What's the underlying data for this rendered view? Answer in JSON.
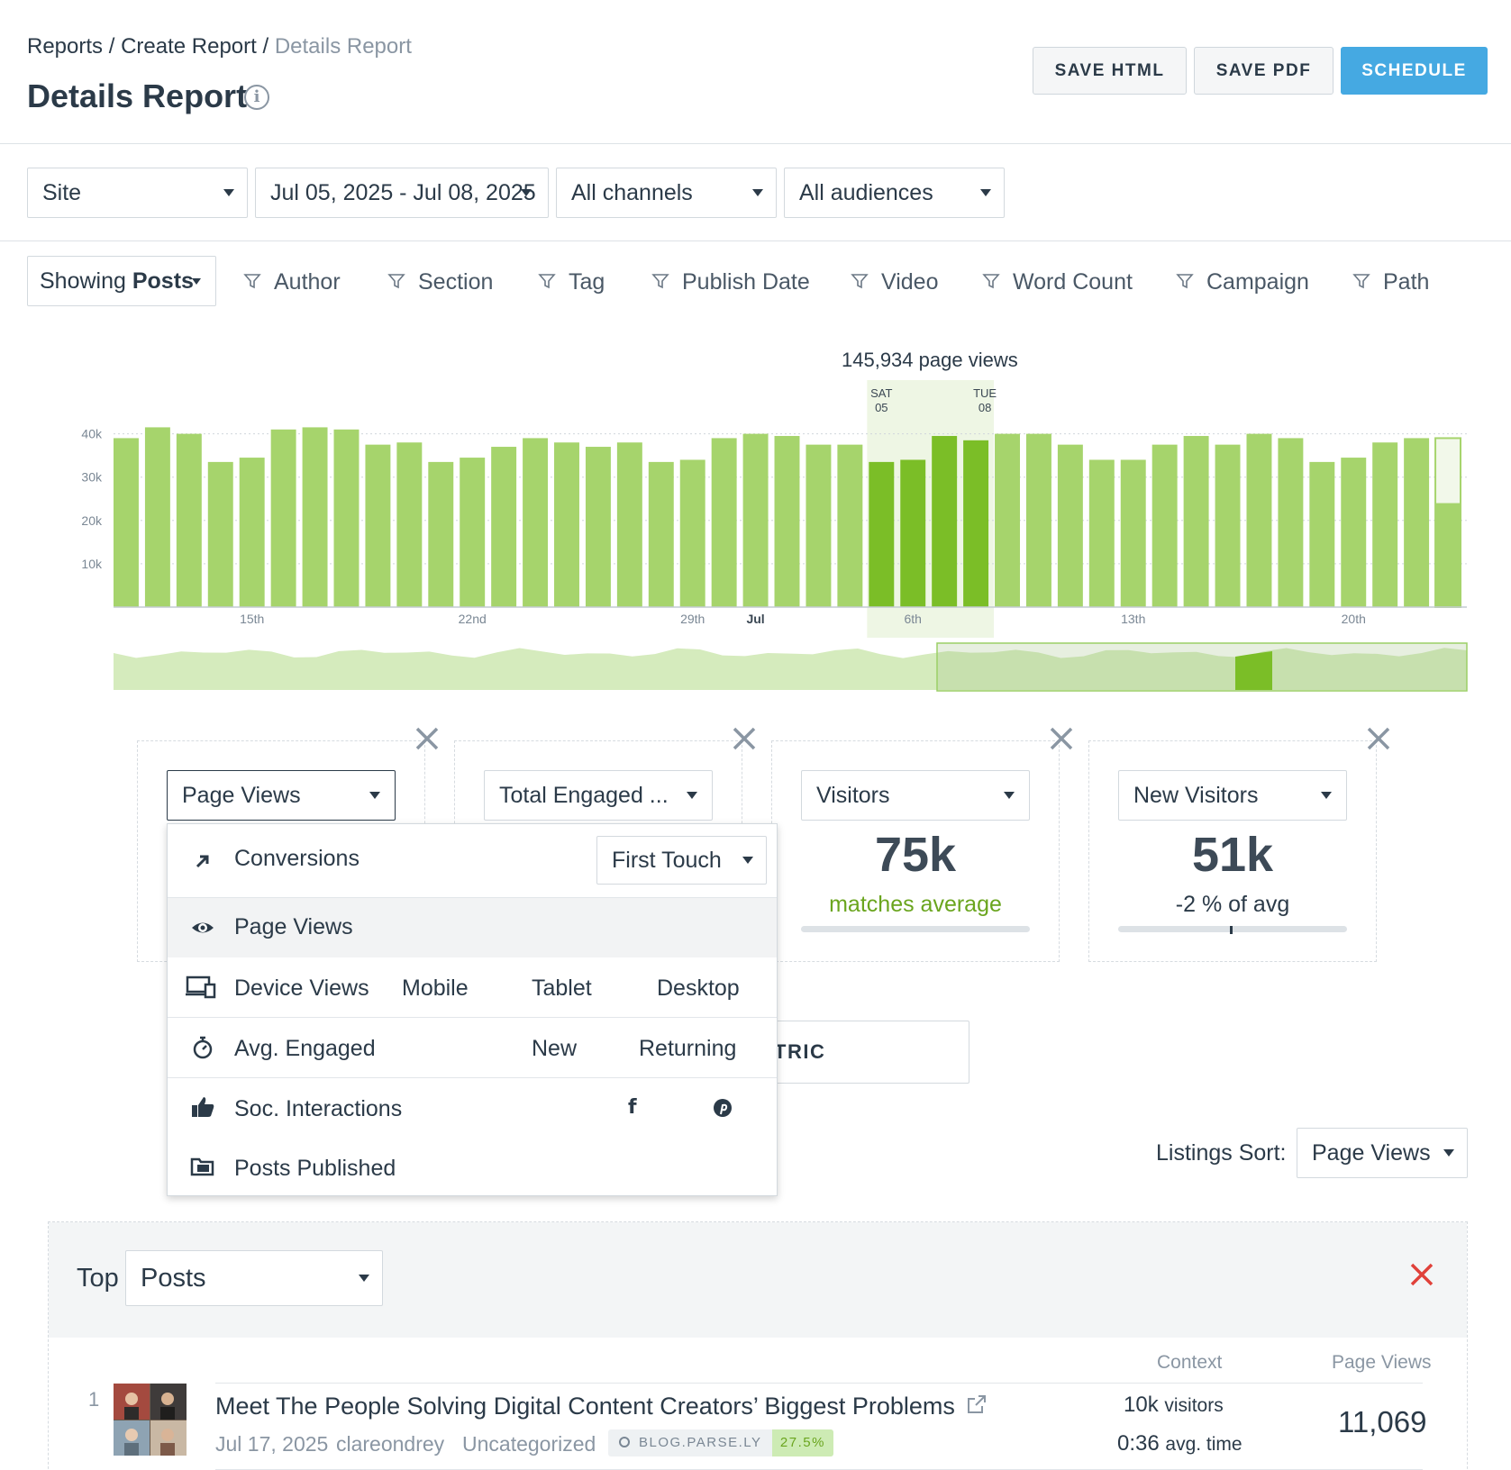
{
  "header": {
    "breadcrumb": [
      "Reports",
      "Create Report",
      "Details Report"
    ],
    "breadcrumb_sep": "/",
    "title": "Details Report",
    "buttons": {
      "save_html": "SAVE HTML",
      "save_pdf": "SAVE PDF",
      "schedule": "SCHEDULE"
    }
  },
  "filters": {
    "site": "Site",
    "date_range": "Jul 05, 2025 - Jul 08, 2025",
    "channels": "All channels",
    "audiences": "All audiences"
  },
  "content_filters": {
    "showing_prefix": "Showing",
    "showing_value": "Posts",
    "items": [
      "Author",
      "Section",
      "Tag",
      "Publish Date",
      "Video",
      "Word Count",
      "Campaign",
      "Path"
    ]
  },
  "chart_data": {
    "type": "bar",
    "title": "145,934 page views",
    "selection_start": {
      "day": "SAT",
      "date": "05"
    },
    "selection_end": {
      "day": "TUE",
      "date": "08"
    },
    "y_ticks": [
      "40k",
      "30k",
      "20k",
      "10k"
    ],
    "ylim": [
      0,
      42000
    ],
    "x_tick_labels": [
      {
        "label": "15th",
        "index": 4
      },
      {
        "label": "22nd",
        "index": 11
      },
      {
        "label": "29th",
        "index": 18
      },
      {
        "label": "Jul",
        "index": 20,
        "bold": true
      },
      {
        "label": "6th",
        "index": 25
      },
      {
        "label": "13th",
        "index": 32
      },
      {
        "label": "20th",
        "index": 39
      }
    ],
    "values": [
      39000,
      41500,
      40000,
      33500,
      34500,
      41000,
      41500,
      41000,
      37500,
      38000,
      33500,
      34500,
      37000,
      39000,
      38000,
      37000,
      38000,
      33500,
      34000,
      39000,
      40000,
      39500,
      37500,
      37500,
      33500,
      34000,
      39500,
      38500,
      40000,
      40000,
      37500,
      34000,
      34000,
      37500,
      39500,
      37500,
      40000,
      39000,
      33500,
      34500,
      38000,
      39000,
      24000
    ],
    "highlight_indices": [
      24,
      25,
      26,
      27
    ],
    "partial_last": true,
    "colors": {
      "bar": "#a6d46c",
      "highlight": "#7bbe27",
      "selection_bg": "#eef6e4",
      "grid": "#d0d6db"
    }
  },
  "metrics": [
    {
      "label": "Page Views"
    },
    {
      "label": "Total Engaged ..."
    },
    {
      "label": "Visitors",
      "value": "75k",
      "comparison": "matches average",
      "comparison_color": "#6aa51e"
    },
    {
      "label": "New Visitors",
      "value": "51k",
      "comparison": "-2 % of avg",
      "comparison_color": "#2b3a48"
    }
  ],
  "add_metric_partial": "TRIC",
  "metric_menu": {
    "conversions": {
      "label": "Conversions",
      "touch": "First Touch"
    },
    "page_views": {
      "label": "Page Views"
    },
    "device_views": {
      "label": "Device Views",
      "options": [
        "Mobile",
        "Tablet",
        "Desktop"
      ]
    },
    "avg_engaged": {
      "label": "Avg. Engaged",
      "options": [
        "New",
        "Returning"
      ]
    },
    "soc_interactions": {
      "label": "Soc. Interactions",
      "icons": [
        "facebook-icon",
        "pinterest-icon"
      ]
    },
    "posts_published": {
      "label": "Posts Published"
    }
  },
  "listings": {
    "sort_label": "Listings Sort:",
    "sort_value": "Page Views",
    "top_label": "Top",
    "top_value": "Posts",
    "columns": {
      "context": "Context",
      "page_views": "Page Views"
    },
    "rows": [
      {
        "rank": "1",
        "title": "Meet The People Solving Digital Content Creators’ Biggest Problems",
        "date": "Jul 17, 2025",
        "author": "clareondrey",
        "section": "Uncategorized",
        "domain": "BLOG.PARSE.LY",
        "domain_pct": "27.5%",
        "visitors_value": "10k",
        "visitors_label": "visitors",
        "time_value": "0:36",
        "time_label": "avg. time",
        "page_views": "11,069"
      }
    ]
  },
  "colors": {
    "accent": "#45a9e2",
    "close_red": "#e0413a",
    "green": "#6aa51e"
  }
}
